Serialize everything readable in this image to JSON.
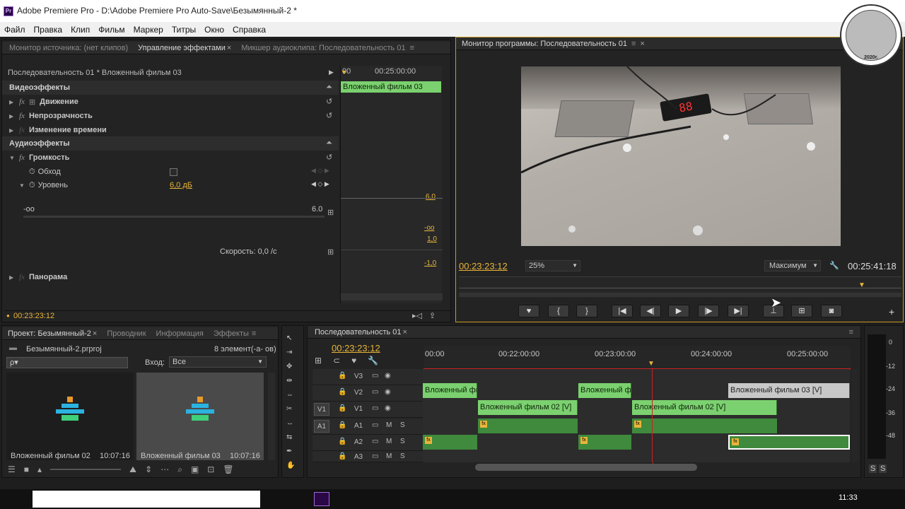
{
  "window": {
    "title": "Adobe Premiere Pro - D:\\Adobe Premiere Pro Auto-Save\\Безымянный-2 *",
    "icon": "Pr"
  },
  "menu": [
    "Файл",
    "Правка",
    "Клип",
    "Фильм",
    "Маркер",
    "Титры",
    "Окно",
    "Справка"
  ],
  "logo": {
    "year": "2020г."
  },
  "source_panel": {
    "tabs": [
      "Монитор источника: (нет клипов)",
      "Управление эффектами",
      "Микшер аудиоклипа: Последовательность 01"
    ]
  },
  "effects": {
    "sequence": "Последовательность 01 * Вложенный фильм  03",
    "video_header": "Видеоэффекты",
    "motion": "Движение",
    "opacity": "Непрозрачность",
    "time_remap": "Изменение времени",
    "audio_header": "Аудиоэффекты",
    "volume": "Громкость",
    "bypass": "Обход",
    "level": "Уровень",
    "level_value": "6,0 дБ",
    "min": "-oo",
    "max": "6.0",
    "speed": "Скорость: 0,0 /с",
    "panorama": "Панорама",
    "graph_vals": [
      "6,0",
      "-oo",
      "1,0",
      "-1,0"
    ],
    "mini_time": "00:25:00:00",
    "mini_start": "00",
    "mini_clip": "Вложенный фильм  03",
    "timecode": "00:23:23:12"
  },
  "program": {
    "tab": "Монитор программы: Последовательность 01",
    "timecode": "00:23:23:12",
    "zoom": "25%",
    "quality": "Максимум",
    "duration": "00:25:41:18",
    "display_readout": "88"
  },
  "project": {
    "tabs": [
      "Проект: Безымянный-2",
      "Проводник",
      "Информация",
      "Эффекты"
    ],
    "file": "Безымянный-2.prproj",
    "count": "8 элемент(-а- ов)",
    "input_label": "Вход:",
    "input_value": "Все",
    "items": [
      {
        "name": "Вложенный фильм  02",
        "dur": "10:07:16"
      },
      {
        "name": "Вложенный фильм  03",
        "dur": "10:07:16"
      }
    ],
    "search_placeholder": "ρ▾"
  },
  "timeline": {
    "tab": "Последовательность 01",
    "timecode": "00:23:23:12",
    "ruler": [
      "00:00",
      "00:22:00:00",
      "00:23:00:00",
      "00:24:00:00",
      "00:25:00:00"
    ],
    "tracks": [
      "V3",
      "V2",
      "V1",
      "A1",
      "A2",
      "A3"
    ],
    "src_v": "V1",
    "src_a": "A1",
    "m": "M",
    "s": "S",
    "clips": {
      "v2a": "Вложенный фи",
      "v2b": "Вложенный фи",
      "v2c": "Вложенный фильм  03 [V]",
      "v1a": "Вложенный фильм  02 [V]",
      "v1b": "Вложенный фильм  02 [V]"
    }
  },
  "meter": {
    "scale": [
      "0",
      "-12",
      "-24",
      "-36",
      "-48"
    ],
    "solo": [
      "S",
      "S"
    ]
  },
  "taskbar": {
    "time": "11:33"
  }
}
